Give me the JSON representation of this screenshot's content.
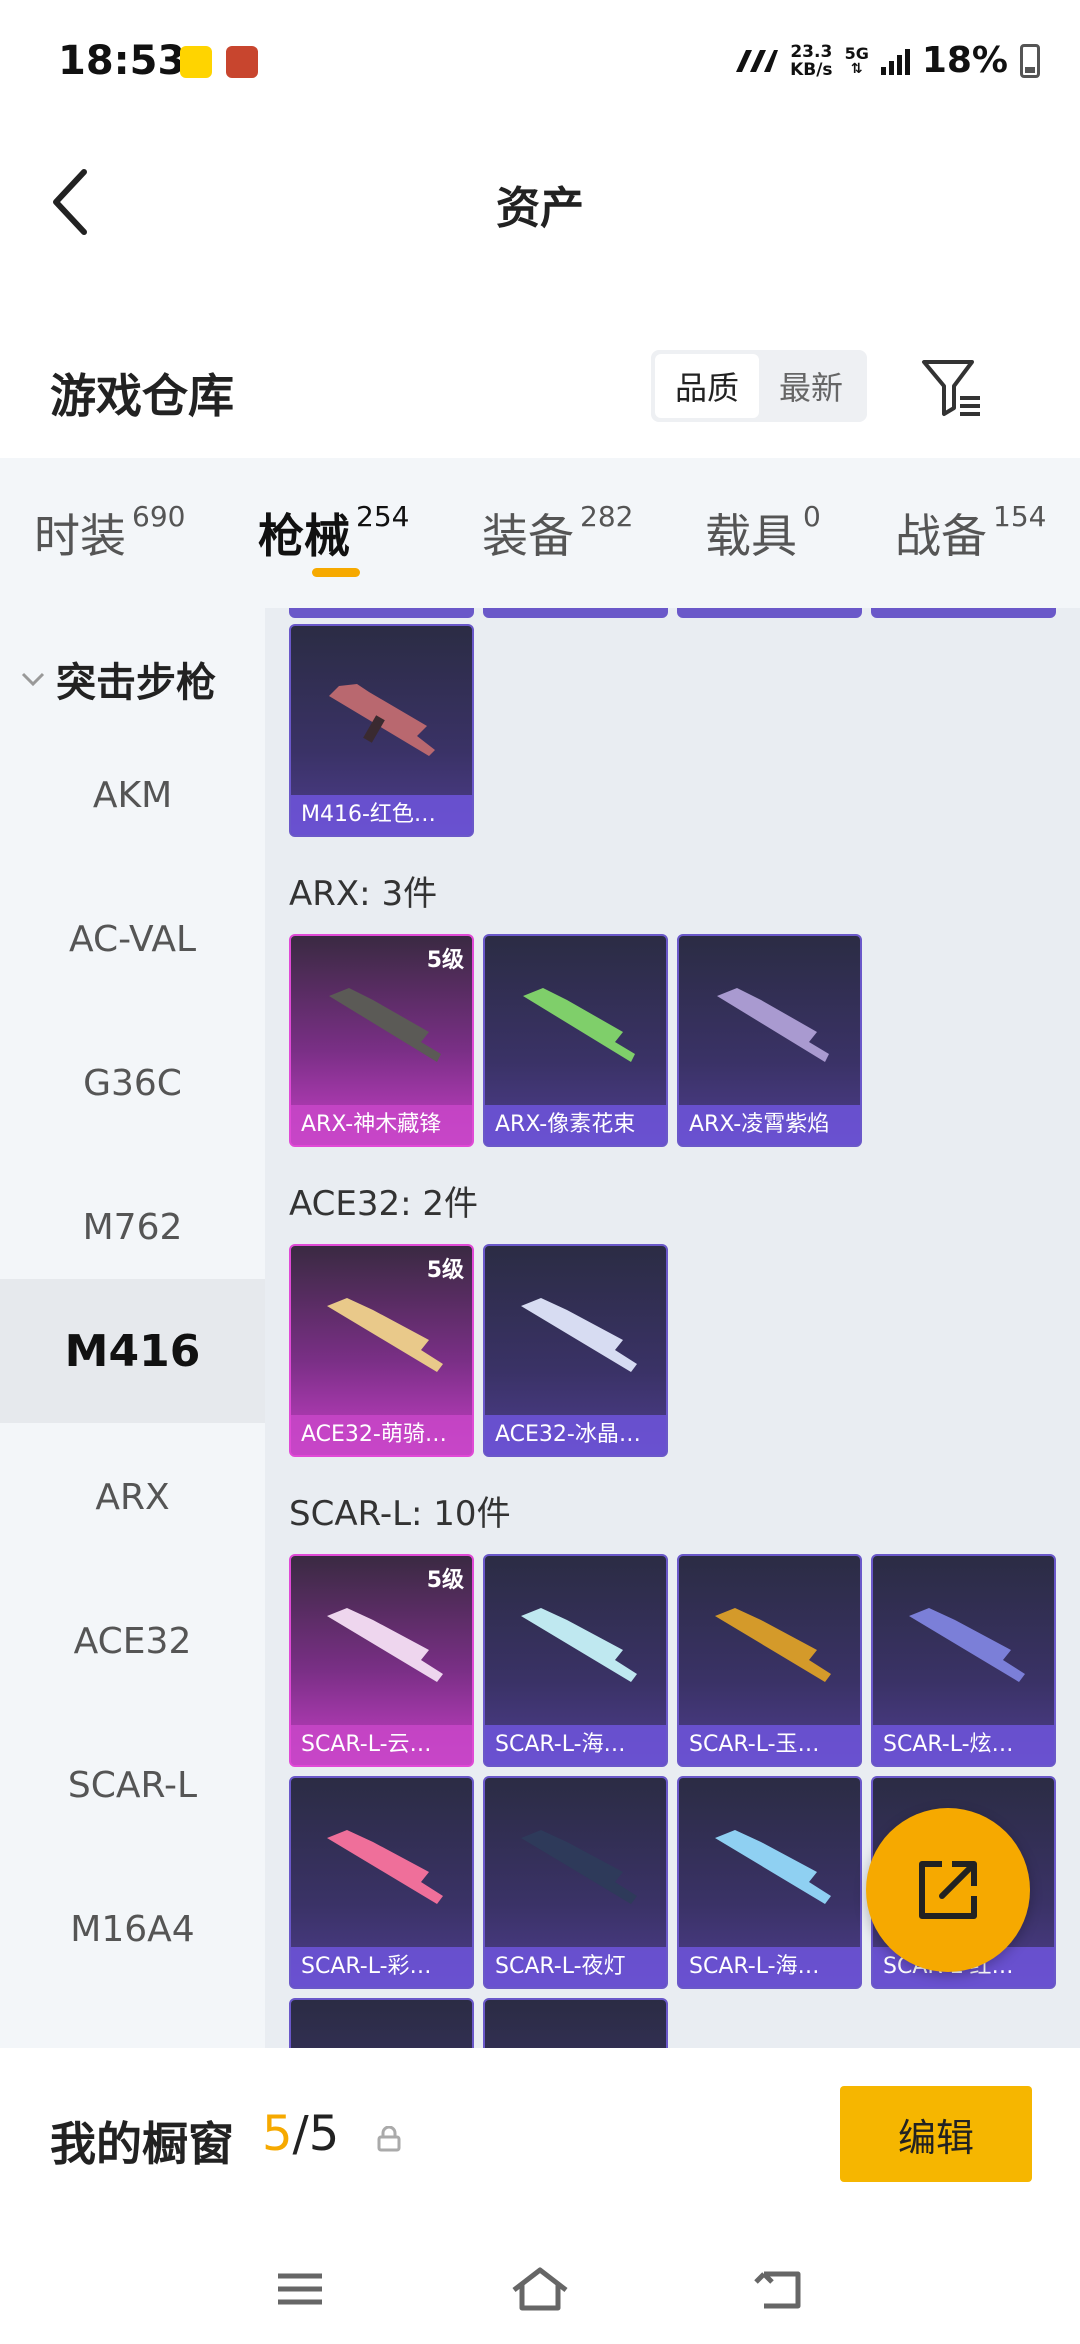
{
  "status_bar": {
    "time": "18:53",
    "net_speed_value": "23.3",
    "net_speed_unit": "KB/s",
    "network": "5G",
    "battery": "18%"
  },
  "header": {
    "title": "资产"
  },
  "warehouse": {
    "title": "游戏仓库",
    "sort_options": [
      "品质",
      "最新"
    ],
    "selected_sort": "品质"
  },
  "tabs": [
    {
      "label": "时装",
      "count": "690"
    },
    {
      "label": "枪械",
      "count": "254"
    },
    {
      "label": "装备",
      "count": "282"
    },
    {
      "label": "载具",
      "count": "0"
    },
    {
      "label": "战备",
      "count": "154"
    }
  ],
  "sidebar": {
    "header": "突击步枪",
    "items": [
      "AKM",
      "AC-VAL",
      "G36C",
      "M762",
      "M416",
      "ARX",
      "ACE32",
      "SCAR-L",
      "M16A4"
    ],
    "selected": "M416"
  },
  "content": {
    "m416_items": [
      {
        "name": "M416-红色…",
        "level": ""
      }
    ],
    "arx": {
      "title": "ARX: 3件",
      "items": [
        {
          "name": "ARX-神木藏锋",
          "level": "5级"
        },
        {
          "name": "ARX-像素花束",
          "level": ""
        },
        {
          "name": "ARX-凌霄紫焰",
          "level": ""
        }
      ]
    },
    "ace32": {
      "title": "ACE32: 2件",
      "items": [
        {
          "name": "ACE32-萌骑…",
          "level": "5级"
        },
        {
          "name": "ACE32-冰晶…",
          "level": ""
        }
      ]
    },
    "scarl": {
      "title": "SCAR-L: 10件",
      "items": [
        {
          "name": "SCAR-L-云…",
          "level": "5级"
        },
        {
          "name": "SCAR-L-海…",
          "level": ""
        },
        {
          "name": "SCAR-L-玉…",
          "level": ""
        },
        {
          "name": "SCAR-L-炫…",
          "level": ""
        },
        {
          "name": "SCAR-L-彩…",
          "level": ""
        },
        {
          "name": "SCAR-L-夜灯",
          "level": ""
        },
        {
          "name": "SCAR-L-海…",
          "level": ""
        },
        {
          "name": "SCAR-L-红…",
          "level": ""
        }
      ]
    }
  },
  "showcase": {
    "title": "我的橱窗",
    "count_current": "5",
    "count_sep_total": "/5",
    "edit_label": "编辑"
  },
  "colors": {
    "accent": "#f6a900",
    "card_purple": "#6a58c9",
    "card_gold": "#e04ad6"
  }
}
